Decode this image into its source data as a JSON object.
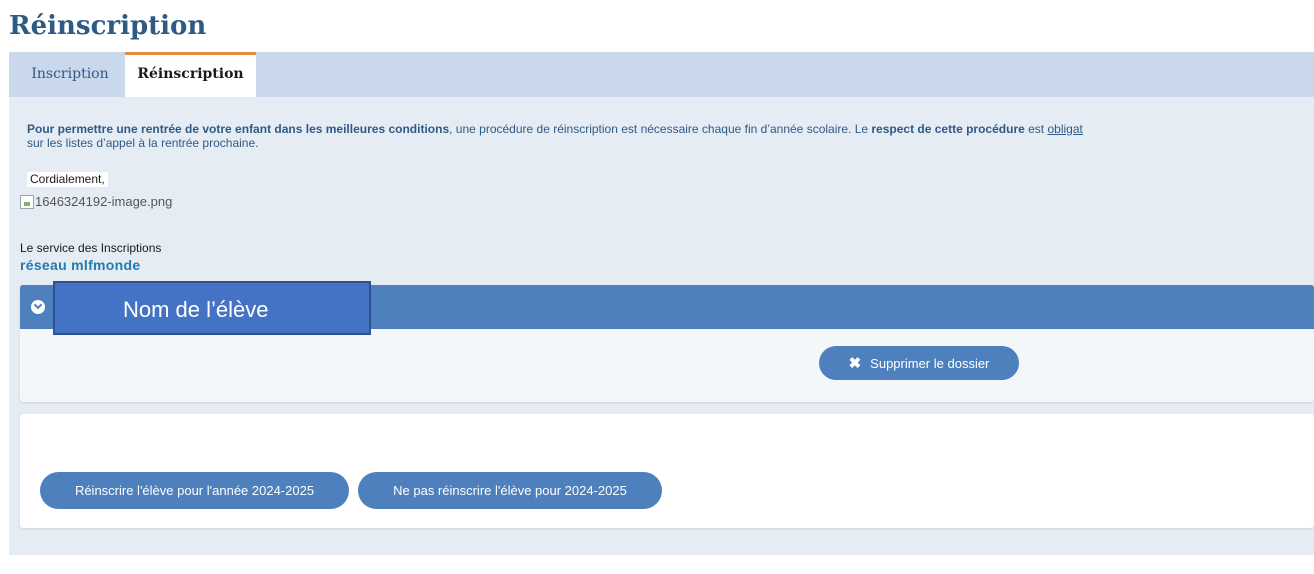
{
  "page": {
    "title": "Réinscription"
  },
  "tabs": [
    {
      "label": "Inscription",
      "active": false
    },
    {
      "label": "Réinscription",
      "active": true
    }
  ],
  "intro": {
    "part1_bold": "Pour permettre une rentrée de votre enfant dans les meilleures conditions",
    "part2": ", une procédure de réinscription est nécessaire chaque fin d’année scolaire. Le ",
    "part3_bold": "respect de cette procédure",
    "part4": " est ",
    "part5_underline": "obligat",
    "line2": "sur les listes d’appel à la rentrée prochaine."
  },
  "signature": {
    "greeting": "Cordialement,",
    "image_alt": "1646324192-image.png",
    "service": "Le service des Inscriptions",
    "network": "réseau mlfmonde"
  },
  "student_panel": {
    "student_name": "Nom de l’élève",
    "delete_label": "Supprimer le dossier"
  },
  "actions": {
    "reinscrire_label": "Réinscrire l'élève pour l'année 2024-2025",
    "ne_pas_label": "Ne pas réinscrire l'élève pour 2024-2025"
  },
  "colors": {
    "title": "#2f5a86",
    "tab_active_border": "#e8893c",
    "primary": "#4e80bd",
    "name_overlay": "#4472c4",
    "network_text": "#1f7bb0"
  },
  "icons": {
    "collapse": "chevron-down-circle-icon",
    "delete": "close-icon",
    "broken_image": "broken-image-icon"
  }
}
